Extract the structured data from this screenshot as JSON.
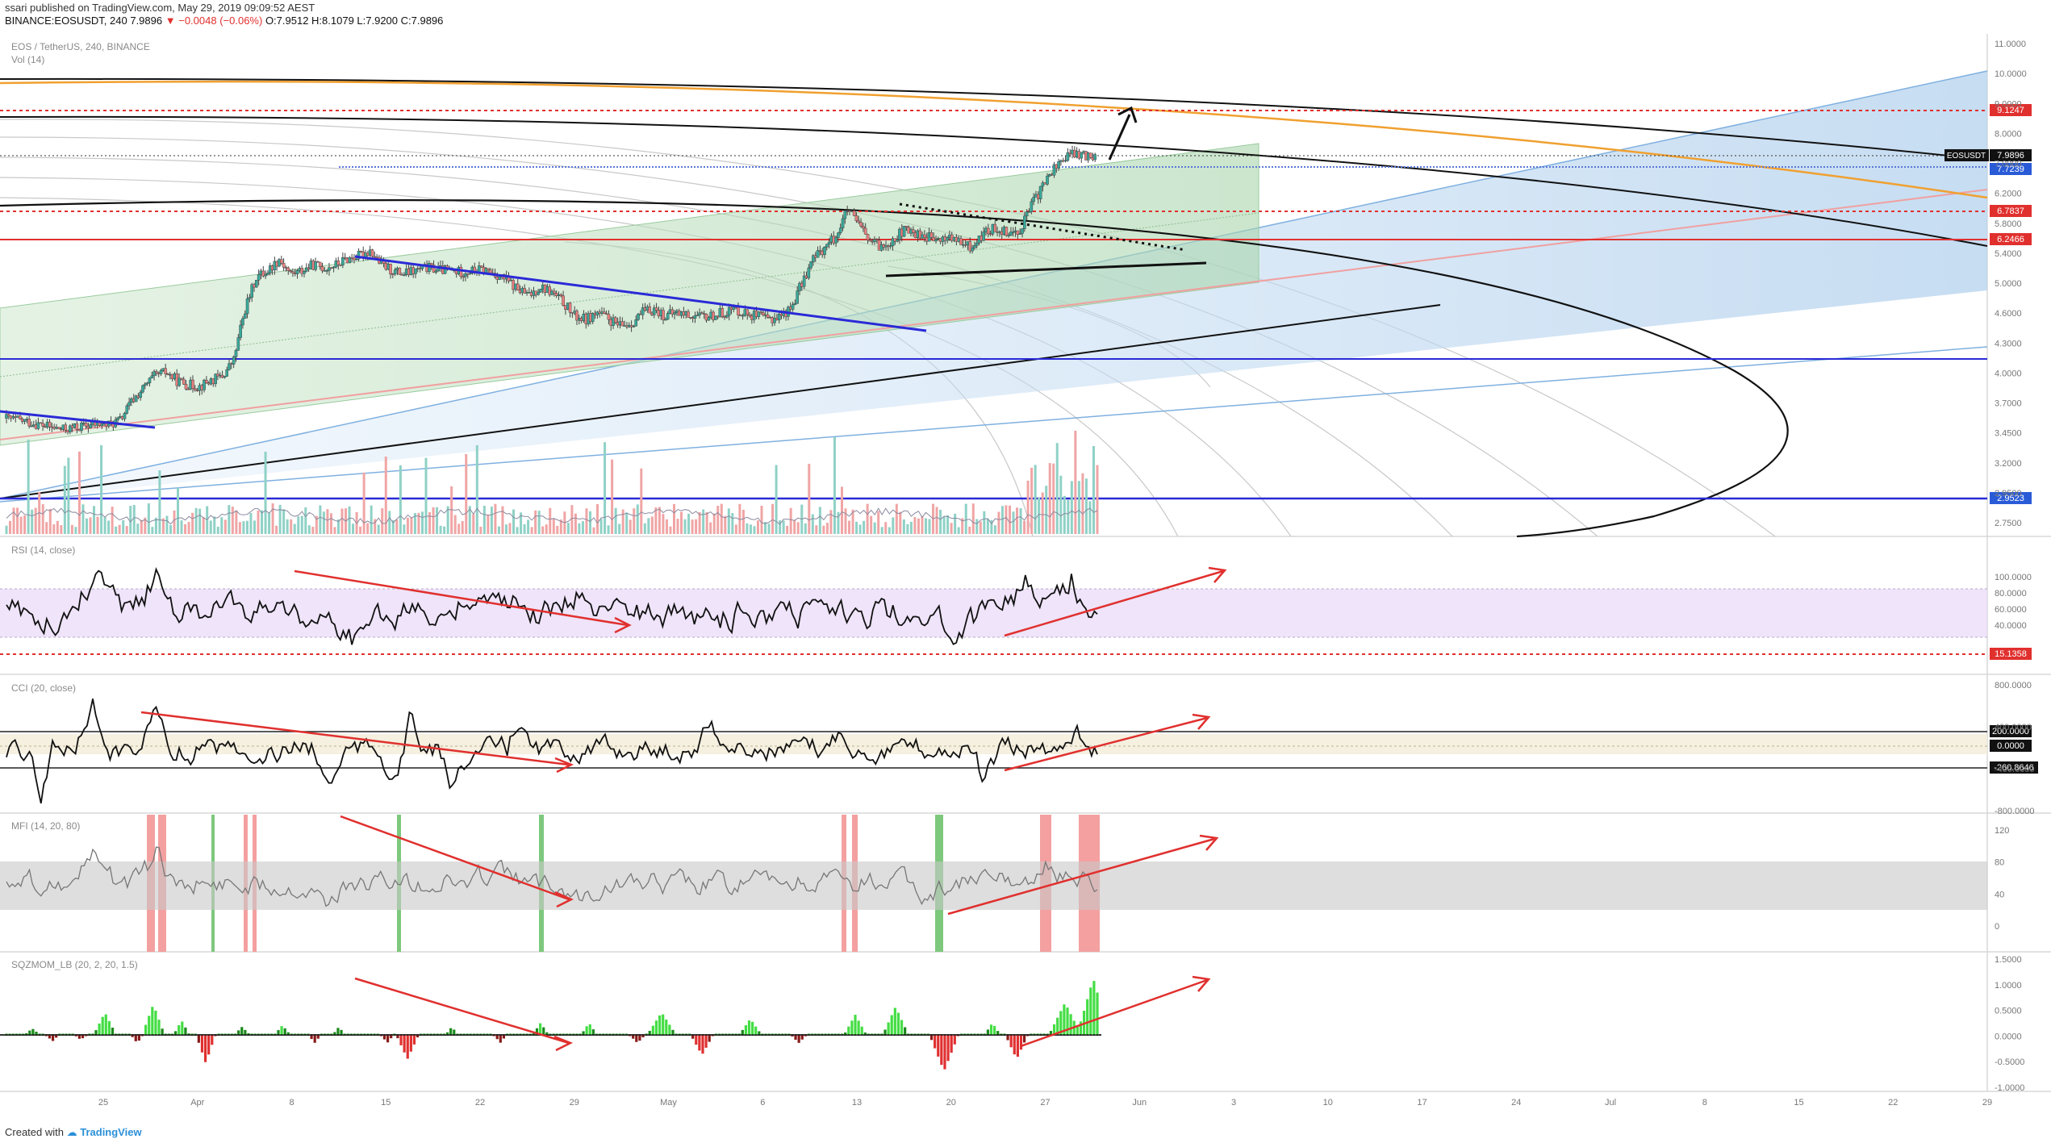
{
  "header": {
    "publisher_line": "ssari published on TradingView.com, May 29, 2019 09:09:52 AEST",
    "symbol": "BINANCE:EOSUSDT, 240",
    "last": "7.9896",
    "change": "−0.0048 (−0.06%)",
    "ohlc": "O:7.9512 H:8.1079 L:7.9200 C:7.9896"
  },
  "footer": {
    "created_with": "Created with",
    "brand": "TradingView"
  },
  "chart_data": [
    {
      "type": "candlestick",
      "title": "EOS / TetherUS, 240, BINANCE",
      "volume_label": "Vol (14)",
      "yticks": [
        "11.0000",
        "10.0000",
        "9.0000",
        "8.0000",
        "7.0000",
        "6.2000",
        "5.8000",
        "5.4000",
        "5.0000",
        "4.6000",
        "4.3000",
        "4.0000",
        "3.7000",
        "3.4500",
        "3.2000",
        "2.9500",
        "2.7500"
      ],
      "xticks": [
        "25",
        "Apr",
        "8",
        "15",
        "22",
        "29",
        "May",
        "6",
        "13",
        "20",
        "27",
        "Jun",
        "3",
        "10",
        "17",
        "24",
        "Jul",
        "8",
        "15",
        "22",
        "29"
      ],
      "price_labels": [
        {
          "text": "9.1247",
          "color": "#e0302e"
        },
        {
          "text": "EOSUSDT",
          "color": "#111111"
        },
        {
          "text": "7.9896",
          "color": "#111111"
        },
        {
          "text": "7.7239",
          "color": "#2a5bd7"
        },
        {
          "text": "6.7837",
          "color": "#e0302e"
        },
        {
          "text": "6.2466",
          "color": "#e0302e"
        },
        {
          "text": "2.9523",
          "color": "#2a5bd7"
        }
      ],
      "close_series": [
        3.72,
        3.7,
        3.68,
        3.65,
        3.62,
        3.6,
        3.62,
        3.64,
        3.66,
        3.65,
        3.7,
        3.9,
        4.05,
        4.2,
        4.25,
        4.15,
        4.1,
        4.08,
        4.15,
        4.2,
        4.4,
        5.1,
        5.6,
        5.7,
        5.9,
        5.65,
        5.7,
        5.8,
        5.75,
        5.8,
        5.9,
        5.95,
        6.05,
        5.8,
        5.7,
        5.65,
        5.7,
        5.75,
        5.72,
        5.7,
        5.68,
        5.7,
        5.72,
        5.65,
        5.55,
        5.4,
        5.3,
        5.45,
        5.35,
        5.2,
        5.0,
        4.95,
        5.05,
        4.95,
        4.85,
        4.9,
        5.05,
        5.1,
        5.0,
        5.05,
        5.02,
        4.98,
        5.0,
        5.05,
        5.1,
        5.05,
        5.0,
        4.95,
        5.0,
        5.1,
        5.5,
        5.9,
        6.1,
        6.3,
        6.8,
        6.5,
        6.2,
        6.1,
        6.25,
        6.4,
        6.35,
        6.3,
        6.2,
        6.3,
        6.15,
        6.1,
        6.35,
        6.45,
        6.4,
        6.35,
        6.8,
        7.2,
        7.6,
        7.9,
        8.0,
        7.95,
        7.99
      ]
    },
    {
      "type": "line",
      "title": "RSI (14, close)",
      "yticks": [
        "100.0000",
        "80.0000",
        "60.0000",
        "40.0000"
      ],
      "price_labels": [
        {
          "text": "15.1358",
          "color": "#e0302e"
        }
      ]
    },
    {
      "type": "line",
      "title": "CCI (20, close)",
      "yticks": [
        "800.0000",
        "400.0000",
        "-400.0000",
        "-800.0000"
      ],
      "price_labels": [
        {
          "text": "200.0000",
          "color": "#111111"
        },
        {
          "text": "0.0000",
          "color": "#111111"
        },
        {
          "text": "-260.8646",
          "color": "#111111"
        }
      ]
    },
    {
      "type": "line",
      "title": "MFI (14, 20, 80)",
      "yticks": [
        "120",
        "80",
        "40",
        "0"
      ]
    },
    {
      "type": "bar",
      "title": "SQZMOM_LB (20, 2, 20, 1.5)",
      "yticks": [
        "1.5000",
        "1.0000",
        "0.5000",
        "0.0000",
        "-0.5000",
        "-1.0000"
      ]
    }
  ]
}
